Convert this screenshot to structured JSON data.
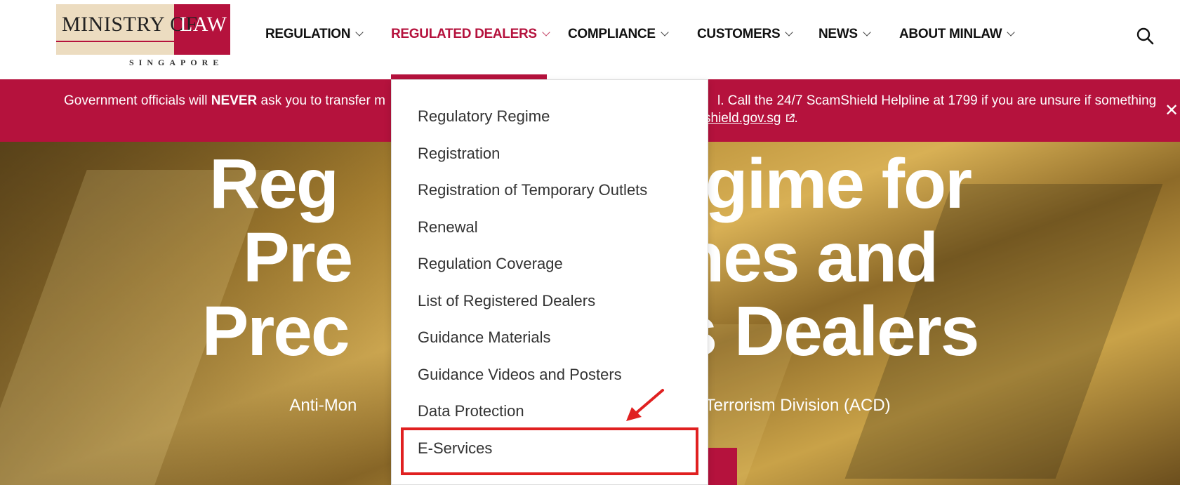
{
  "logo": {
    "ministry": "MINISTRY OF",
    "law": "LAW",
    "country": "SINGAPORE"
  },
  "nav": {
    "items": [
      {
        "label": "REGULATION"
      },
      {
        "label": "REGULATED DEALERS"
      },
      {
        "label": "COMPLIANCE"
      },
      {
        "label": "CUSTOMERS"
      },
      {
        "label": "NEWS"
      },
      {
        "label": "ABOUT MINLAW"
      }
    ],
    "active_index": 1
  },
  "banner": {
    "part1": "Government officials will ",
    "never": "NEVER",
    "part2": " ask you to transfer m",
    "part3": "l. Call the 24/7 ScamShield Helpline at 1799 if you are unsure if something",
    "link": "shield.gov.sg",
    "after_link": ".",
    "close": "✕"
  },
  "hero": {
    "line1": "Regulatory Regime for",
    "line2": "Precious Stones and",
    "line3": "Precious Metals Dealers",
    "line1_visible_left": "Reg",
    "line1_visible_right": "egime for",
    "line2_visible_left": "Pre",
    "line2_visible_right": "nes and",
    "line3_visible_left": "Prec",
    "line3_visible_right": "s Dealers",
    "subtitle_left": "Anti-Mon",
    "subtitle_right": "of Terrorism Division (ACD)"
  },
  "dropdown": {
    "items": [
      {
        "label": "Regulatory Regime"
      },
      {
        "label": "Registration"
      },
      {
        "label": "Registration of Temporary Outlets"
      },
      {
        "label": "Renewal"
      },
      {
        "label": "Regulation Coverage"
      },
      {
        "label": "List of Registered Dealers"
      },
      {
        "label": "Guidance Materials"
      },
      {
        "label": "Guidance Videos and Posters"
      },
      {
        "label": "Data Protection"
      },
      {
        "label": "E-Services"
      }
    ],
    "highlighted_index": 9
  },
  "colors": {
    "brand_red": "#b5123d",
    "annotation_red": "#e02020",
    "logo_beige": "#ecdcc0"
  }
}
